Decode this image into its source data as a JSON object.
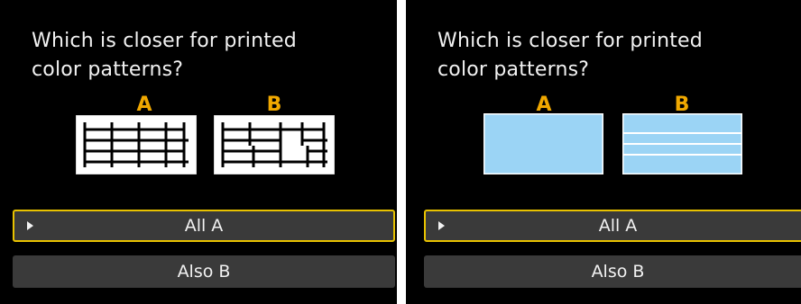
{
  "panels": [
    {
      "question": "Which is closer for printed\ncolor patterns?",
      "choice_a": "A",
      "choice_b": "B",
      "pattern_style": "grid-lines",
      "options": [
        {
          "label": "All A",
          "selected": true
        },
        {
          "label": "Also B",
          "selected": false
        }
      ]
    },
    {
      "question": "Which is closer for printed\ncolor patterns?",
      "choice_a": "A",
      "choice_b": "B",
      "pattern_style": "color-fill",
      "options": [
        {
          "label": "All A",
          "selected": true
        },
        {
          "label": "Also B",
          "selected": false
        }
      ]
    }
  ],
  "colors": {
    "panel_bg": "#000000",
    "accent_letter": "#f0a800",
    "selection_border": "#e8c200",
    "button_bg": "#3a3a3a",
    "pattern_fill": "#9bd4f5"
  },
  "icons": {
    "selection_cursor": "right-triangle-icon"
  }
}
